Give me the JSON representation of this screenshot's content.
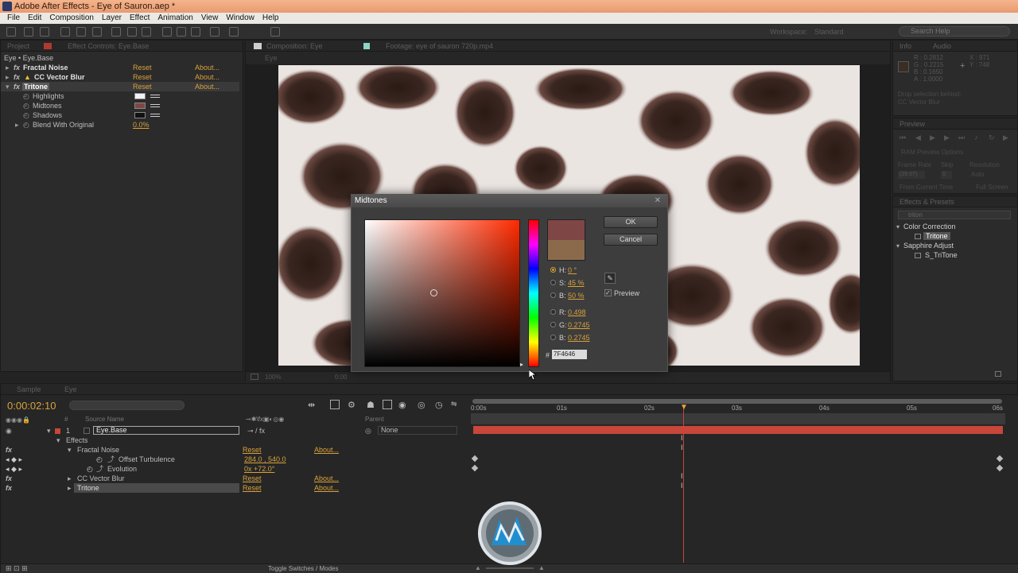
{
  "window": {
    "title": "Adobe After Effects - Eye of Sauron.aep *"
  },
  "menu": [
    "File",
    "Edit",
    "Composition",
    "Layer",
    "Effect",
    "Animation",
    "View",
    "Window",
    "Help"
  ],
  "toolbar": {
    "workspace_label": "Workspace:",
    "workspace_value": "Standard",
    "search_placeholder": "Search Help"
  },
  "effect_controls": {
    "tabs": [
      "Project",
      "Effect Controls: Eye.Base"
    ],
    "header": "Eye • Eye.Base",
    "effects": [
      {
        "name": "Fractal Noise",
        "reset": "Reset",
        "about": "About..."
      },
      {
        "name": "CC Vector Blur",
        "reset": "Reset",
        "about": "About..."
      },
      {
        "name": "Tritone",
        "reset": "Reset",
        "about": "About..."
      }
    ],
    "params": [
      {
        "name": "Highlights",
        "color": "#f2f2f2"
      },
      {
        "name": "Midtones",
        "color": "#7f4646"
      },
      {
        "name": "Shadows",
        "color": "#111111"
      }
    ],
    "blend": {
      "name": "Blend With Original",
      "value": "0.0%"
    }
  },
  "composition": {
    "tabs": [
      "Composition: Eye",
      "Footage: eye of sauron 720p.mp4"
    ],
    "breadcrumb": "Eye",
    "zoom": "100%",
    "time_readout": "0:00"
  },
  "dialog": {
    "title": "Midtones",
    "ok": "OK",
    "cancel": "Cancel",
    "hsb": [
      {
        "label": "H:",
        "value": "0 °",
        "selected": true
      },
      {
        "label": "S:",
        "value": "45 %",
        "selected": false
      },
      {
        "label": "B:",
        "value": "50 %",
        "selected": false
      }
    ],
    "rgb": [
      {
        "label": "R:",
        "value": "0.498"
      },
      {
        "label": "G:",
        "value": "0.2745"
      },
      {
        "label": "B:",
        "value": "0.2745"
      }
    ],
    "hex_label": "#",
    "hex": "7F4646",
    "preview_label": "Preview",
    "preview_checked": true,
    "new_color": "#7f4646",
    "old_color": "#8b6a4b"
  },
  "info_panel": {
    "tabs": [
      "Info",
      "Audio"
    ],
    "values": [
      "R : 0.2812",
      "G : 0.2215",
      "B : 0.1650",
      "A : 1.0000"
    ],
    "coords": [
      "X : 971",
      "Y : 748"
    ],
    "message": [
      "Drop selection behind:",
      "CC Vector Blur"
    ]
  },
  "preview_panel": {
    "tab": "Preview",
    "ram_label": "RAM Preview Options",
    "frame_rate_label": "Frame Rate",
    "skip_label": "Skip",
    "resolution_label": "Resolution",
    "frame_rate_value": "(29.97)",
    "skip_value": "0",
    "resolution_value": "Auto",
    "from_current": "From Current Time",
    "full_screen": "Full Screen"
  },
  "effects_presets": {
    "tab": "Effects & Presets",
    "search_value": "triton",
    "categories": [
      {
        "name": "Color Correction",
        "items": [
          "Tritone"
        ]
      },
      {
        "name": "Sapphire Adjust",
        "items": [
          "S_TriTone"
        ]
      }
    ]
  },
  "timeline": {
    "tabs": [
      "Sample",
      "Eye"
    ],
    "current_time": "0:00:02:10",
    "columns": {
      "source_name": "Source Name",
      "parent": "Parent",
      "index": "#"
    },
    "layer": {
      "index": "1",
      "name": "Eye.Base",
      "parent": "None"
    },
    "rows": [
      {
        "label": "Effects",
        "level": 1
      },
      {
        "label": "Fractal Noise",
        "level": 2,
        "reset": "Reset",
        "about": "About..."
      },
      {
        "label": "Offset Turbulence",
        "level": 3,
        "value": "284.0 , 540.0"
      },
      {
        "label": "Evolution",
        "level": 3,
        "value": "0x +72.0°"
      },
      {
        "label": "CC Vector Blur",
        "level": 2,
        "reset": "Reset",
        "about": "About..."
      },
      {
        "label": "Tritone",
        "level": 2,
        "reset": "Reset",
        "about": "About..."
      }
    ],
    "ruler": [
      "0:00s",
      "01s",
      "02s",
      "03s",
      "04s",
      "05s",
      "06s"
    ],
    "toggle_label": "Toggle Switches / Modes"
  }
}
